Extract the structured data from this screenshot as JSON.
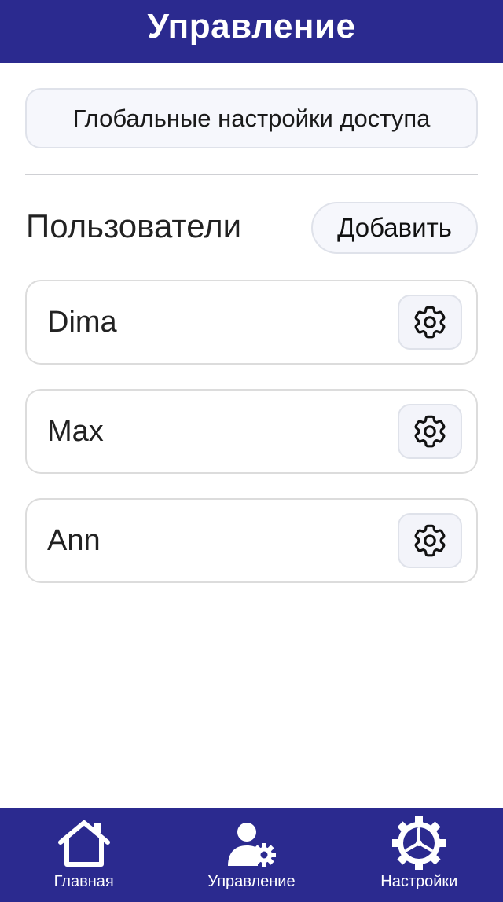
{
  "header": {
    "title": "Управление"
  },
  "global_access_button": {
    "label": "Глобальные настройки доступа"
  },
  "users_section": {
    "title": "Пользователи",
    "add_button_label": "Добавить"
  },
  "users": [
    {
      "name": "Dima",
      "action_icon": "gear-icon"
    },
    {
      "name": "Max",
      "action_icon": "gear-icon"
    },
    {
      "name": "Ann",
      "action_icon": "gear-icon"
    }
  ],
  "bottom_nav": {
    "items": [
      {
        "label": "Главная",
        "icon": "home-icon"
      },
      {
        "label": "Управление",
        "icon": "user-gear-icon"
      },
      {
        "label": "Настройки",
        "icon": "settings-wheel-icon"
      }
    ]
  },
  "colors": {
    "brand": "#2b2a8f",
    "button_bg": "#f6f7fc",
    "border": "#dcdcdc"
  }
}
